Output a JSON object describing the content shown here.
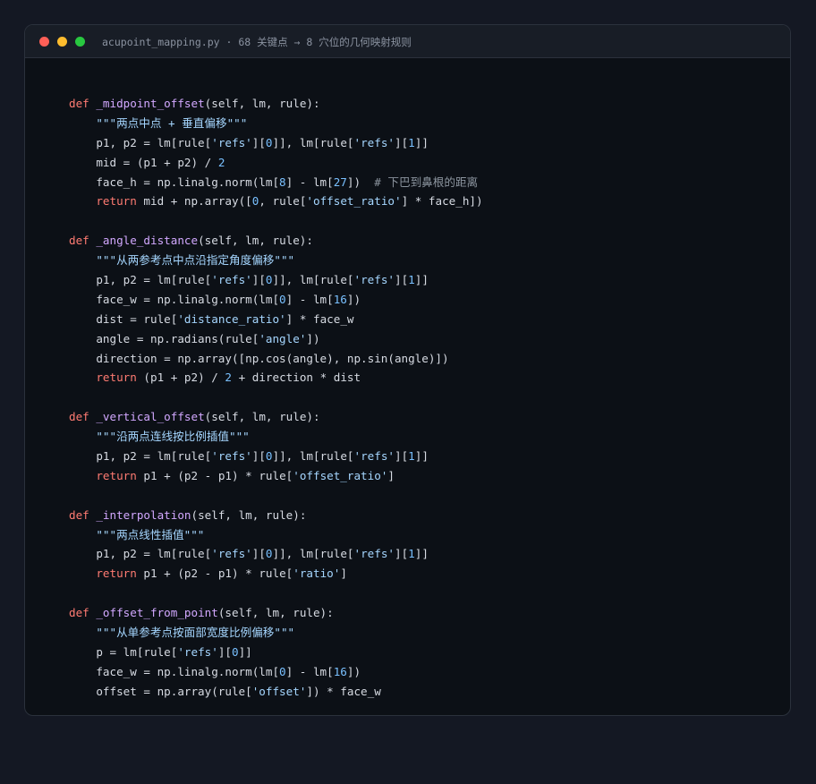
{
  "window": {
    "title": "acupoint_mapping.py · 68 关键点 → 8 穴位的几何映射规则"
  },
  "code": {
    "lines": [
      [
        {
          "t": "def ",
          "c": "kw"
        },
        {
          "t": "_midpoint_offset",
          "c": "fn"
        },
        {
          "t": "(self, lm, rule):",
          "c": ""
        }
      ],
      [
        {
          "t": "    \"\"\"两点中点 + 垂直偏移\"\"\"",
          "c": "str"
        }
      ],
      [
        {
          "t": "    p1, p2 = lm[rule[",
          "c": ""
        },
        {
          "t": "'refs'",
          "c": "str"
        },
        {
          "t": "][",
          "c": ""
        },
        {
          "t": "0",
          "c": "num"
        },
        {
          "t": "]], lm[rule[",
          "c": ""
        },
        {
          "t": "'refs'",
          "c": "str"
        },
        {
          "t": "][",
          "c": ""
        },
        {
          "t": "1",
          "c": "num"
        },
        {
          "t": "]]",
          "c": ""
        }
      ],
      [
        {
          "t": "    mid = (p1 + p2) / ",
          "c": ""
        },
        {
          "t": "2",
          "c": "num"
        }
      ],
      [
        {
          "t": "    face_h = np.linalg.norm(lm[",
          "c": ""
        },
        {
          "t": "8",
          "c": "num"
        },
        {
          "t": "] - lm[",
          "c": ""
        },
        {
          "t": "27",
          "c": "num"
        },
        {
          "t": "])  ",
          "c": ""
        },
        {
          "t": "# 下巴到鼻根的距离",
          "c": "com"
        }
      ],
      [
        {
          "t": "    ",
          "c": ""
        },
        {
          "t": "return",
          "c": "kw"
        },
        {
          "t": " mid + np.array([",
          "c": ""
        },
        {
          "t": "0",
          "c": "num"
        },
        {
          "t": ", rule[",
          "c": ""
        },
        {
          "t": "'offset_ratio'",
          "c": "str"
        },
        {
          "t": "] * face_h])",
          "c": ""
        }
      ],
      [],
      [
        {
          "t": "def ",
          "c": "kw"
        },
        {
          "t": "_angle_distance",
          "c": "fn"
        },
        {
          "t": "(self, lm, rule):",
          "c": ""
        }
      ],
      [
        {
          "t": "    \"\"\"从两参考点中点沿指定角度偏移\"\"\"",
          "c": "str"
        }
      ],
      [
        {
          "t": "    p1, p2 = lm[rule[",
          "c": ""
        },
        {
          "t": "'refs'",
          "c": "str"
        },
        {
          "t": "][",
          "c": ""
        },
        {
          "t": "0",
          "c": "num"
        },
        {
          "t": "]], lm[rule[",
          "c": ""
        },
        {
          "t": "'refs'",
          "c": "str"
        },
        {
          "t": "][",
          "c": ""
        },
        {
          "t": "1",
          "c": "num"
        },
        {
          "t": "]]",
          "c": ""
        }
      ],
      [
        {
          "t": "    face_w = np.linalg.norm(lm[",
          "c": ""
        },
        {
          "t": "0",
          "c": "num"
        },
        {
          "t": "] - lm[",
          "c": ""
        },
        {
          "t": "16",
          "c": "num"
        },
        {
          "t": "])",
          "c": ""
        }
      ],
      [
        {
          "t": "    dist = rule[",
          "c": ""
        },
        {
          "t": "'distance_ratio'",
          "c": "str"
        },
        {
          "t": "] * face_w",
          "c": ""
        }
      ],
      [
        {
          "t": "    angle = np.radians(rule[",
          "c": ""
        },
        {
          "t": "'angle'",
          "c": "str"
        },
        {
          "t": "])",
          "c": ""
        }
      ],
      [
        {
          "t": "    direction = np.array([np.cos(angle), np.sin(angle)])",
          "c": ""
        }
      ],
      [
        {
          "t": "    ",
          "c": ""
        },
        {
          "t": "return",
          "c": "kw"
        },
        {
          "t": " (p1 + p2) / ",
          "c": ""
        },
        {
          "t": "2",
          "c": "num"
        },
        {
          "t": " + direction * dist",
          "c": ""
        }
      ],
      [],
      [
        {
          "t": "def ",
          "c": "kw"
        },
        {
          "t": "_vertical_offset",
          "c": "fn"
        },
        {
          "t": "(self, lm, rule):",
          "c": ""
        }
      ],
      [
        {
          "t": "    \"\"\"沿两点连线按比例插值\"\"\"",
          "c": "str"
        }
      ],
      [
        {
          "t": "    p1, p2 = lm[rule[",
          "c": ""
        },
        {
          "t": "'refs'",
          "c": "str"
        },
        {
          "t": "][",
          "c": ""
        },
        {
          "t": "0",
          "c": "num"
        },
        {
          "t": "]], lm[rule[",
          "c": ""
        },
        {
          "t": "'refs'",
          "c": "str"
        },
        {
          "t": "][",
          "c": ""
        },
        {
          "t": "1",
          "c": "num"
        },
        {
          "t": "]]",
          "c": ""
        }
      ],
      [
        {
          "t": "    ",
          "c": ""
        },
        {
          "t": "return",
          "c": "kw"
        },
        {
          "t": " p1 + (p2 - p1) * rule[",
          "c": ""
        },
        {
          "t": "'offset_ratio'",
          "c": "str"
        },
        {
          "t": "]",
          "c": ""
        }
      ],
      [],
      [
        {
          "t": "def ",
          "c": "kw"
        },
        {
          "t": "_interpolation",
          "c": "fn"
        },
        {
          "t": "(self, lm, rule):",
          "c": ""
        }
      ],
      [
        {
          "t": "    \"\"\"两点线性插值\"\"\"",
          "c": "str"
        }
      ],
      [
        {
          "t": "    p1, p2 = lm[rule[",
          "c": ""
        },
        {
          "t": "'refs'",
          "c": "str"
        },
        {
          "t": "][",
          "c": ""
        },
        {
          "t": "0",
          "c": "num"
        },
        {
          "t": "]], lm[rule[",
          "c": ""
        },
        {
          "t": "'refs'",
          "c": "str"
        },
        {
          "t": "][",
          "c": ""
        },
        {
          "t": "1",
          "c": "num"
        },
        {
          "t": "]]",
          "c": ""
        }
      ],
      [
        {
          "t": "    ",
          "c": ""
        },
        {
          "t": "return",
          "c": "kw"
        },
        {
          "t": " p1 + (p2 - p1) * rule[",
          "c": ""
        },
        {
          "t": "'ratio'",
          "c": "str"
        },
        {
          "t": "]",
          "c": ""
        }
      ],
      [],
      [
        {
          "t": "def ",
          "c": "kw"
        },
        {
          "t": "_offset_from_point",
          "c": "fn"
        },
        {
          "t": "(self, lm, rule):",
          "c": ""
        }
      ],
      [
        {
          "t": "    \"\"\"从单参考点按面部宽度比例偏移\"\"\"",
          "c": "str"
        }
      ],
      [
        {
          "t": "    p = lm[rule[",
          "c": ""
        },
        {
          "t": "'refs'",
          "c": "str"
        },
        {
          "t": "][",
          "c": ""
        },
        {
          "t": "0",
          "c": "num"
        },
        {
          "t": "]]",
          "c": ""
        }
      ],
      [
        {
          "t": "    face_w = np.linalg.norm(lm[",
          "c": ""
        },
        {
          "t": "0",
          "c": "num"
        },
        {
          "t": "] - lm[",
          "c": ""
        },
        {
          "t": "16",
          "c": "num"
        },
        {
          "t": "])",
          "c": ""
        }
      ],
      [
        {
          "t": "    offset = np.array(rule[",
          "c": ""
        },
        {
          "t": "'offset'",
          "c": "str"
        },
        {
          "t": "]) * face_w",
          "c": ""
        }
      ]
    ]
  }
}
